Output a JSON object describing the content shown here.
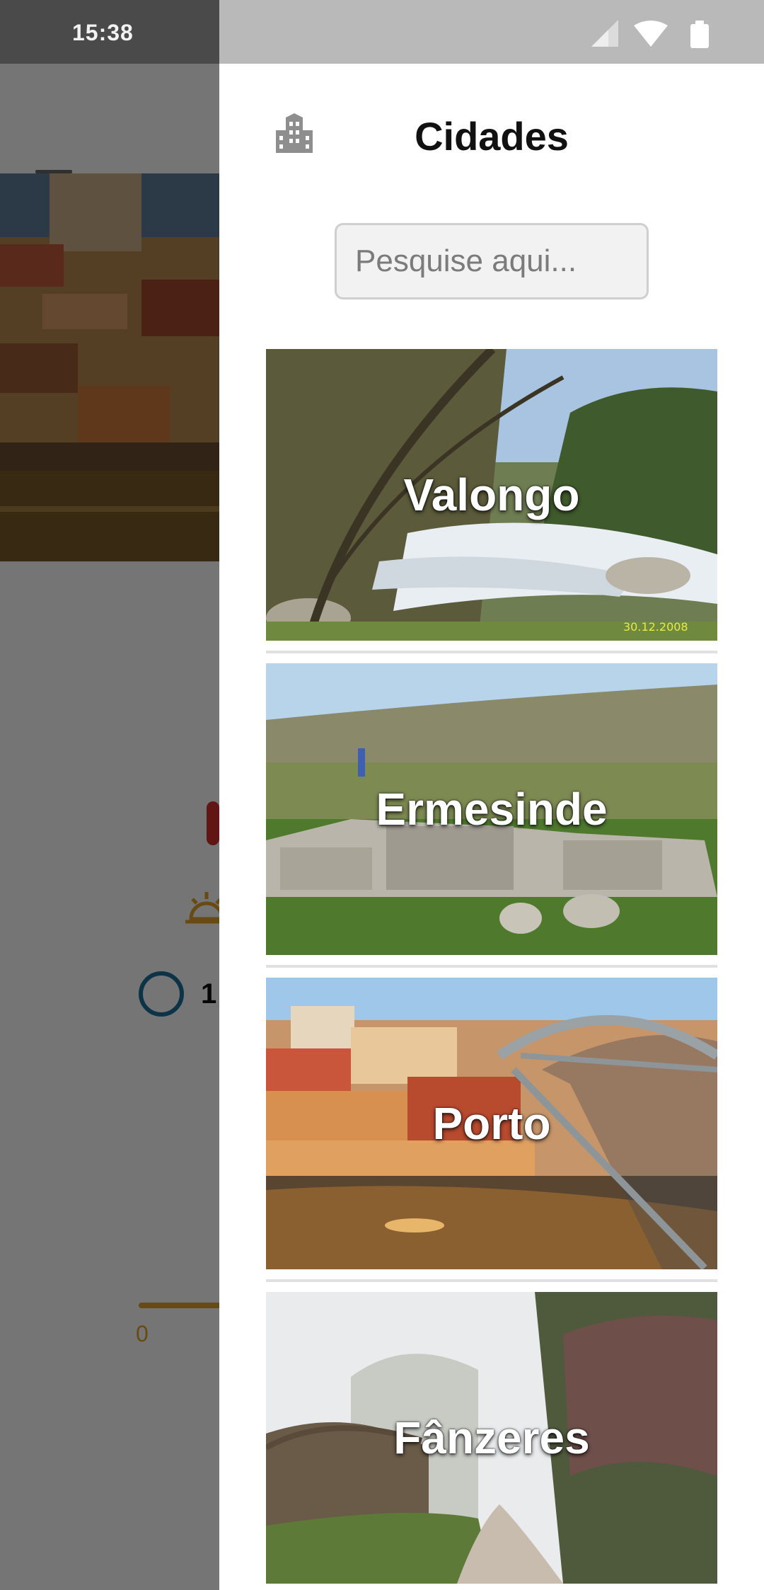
{
  "status_bar": {
    "time": "15:38"
  },
  "background": {
    "gauge_value": "1",
    "slider_min": "0"
  },
  "drawer": {
    "title": "Cidades",
    "search_placeholder": "Pesquise aqui...",
    "cities": [
      {
        "name": "Valongo",
        "photo_stamp": "30.12.2008"
      },
      {
        "name": "Ermesinde"
      },
      {
        "name": "Porto"
      },
      {
        "name": "Fânzeres"
      }
    ]
  },
  "colors": {
    "thermometer": "#d32f2f",
    "sun": "#e2a22c",
    "gauge": "#1e6f9a"
  }
}
